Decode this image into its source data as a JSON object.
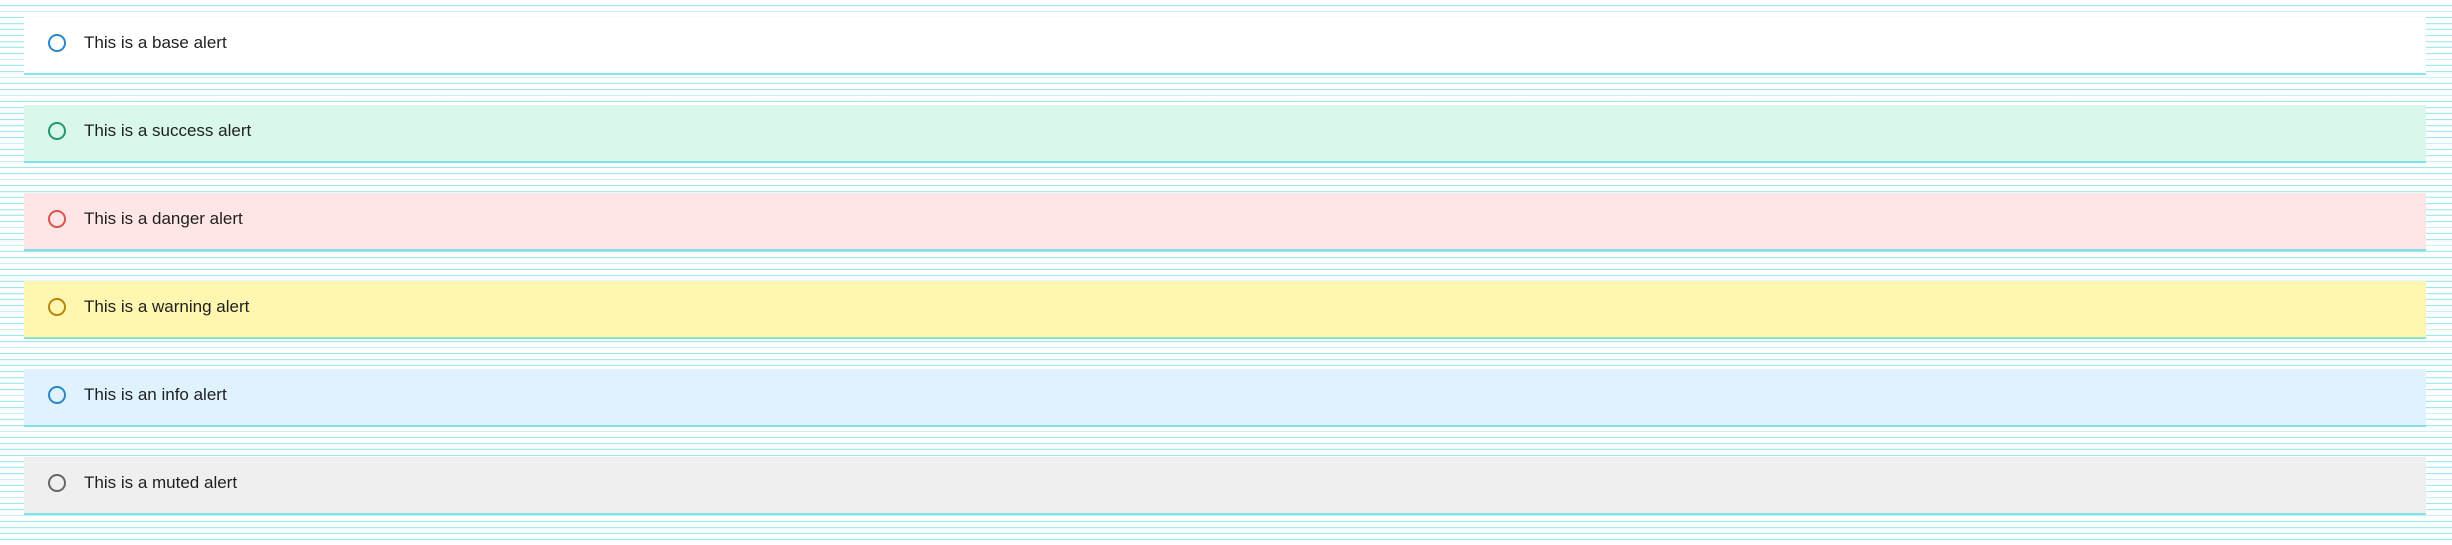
{
  "alerts": [
    {
      "type": "base",
      "text": "This is a base alert",
      "icon": "circle-outline-icon",
      "bg": "#ffffff",
      "icon_color": "#2a87c9"
    },
    {
      "type": "success",
      "text": "This is a success alert",
      "icon": "circle-outline-icon",
      "bg": "#d9f8eb",
      "icon_color": "#1f9a68"
    },
    {
      "type": "danger",
      "text": "This is a danger alert",
      "icon": "circle-outline-icon",
      "bg": "#ffe6e6",
      "icon_color": "#d9534f"
    },
    {
      "type": "warning",
      "text": "This is a warning alert",
      "icon": "circle-outline-icon",
      "bg": "#fff6b0",
      "icon_color": "#b8860b"
    },
    {
      "type": "info",
      "text": "This is an info alert",
      "icon": "circle-outline-icon",
      "bg": "#dff2fd",
      "icon_color": "#2a87c9"
    },
    {
      "type": "muted",
      "text": "This is a muted alert",
      "icon": "circle-outline-icon",
      "bg": "#f0efef",
      "icon_color": "#666666"
    }
  ]
}
